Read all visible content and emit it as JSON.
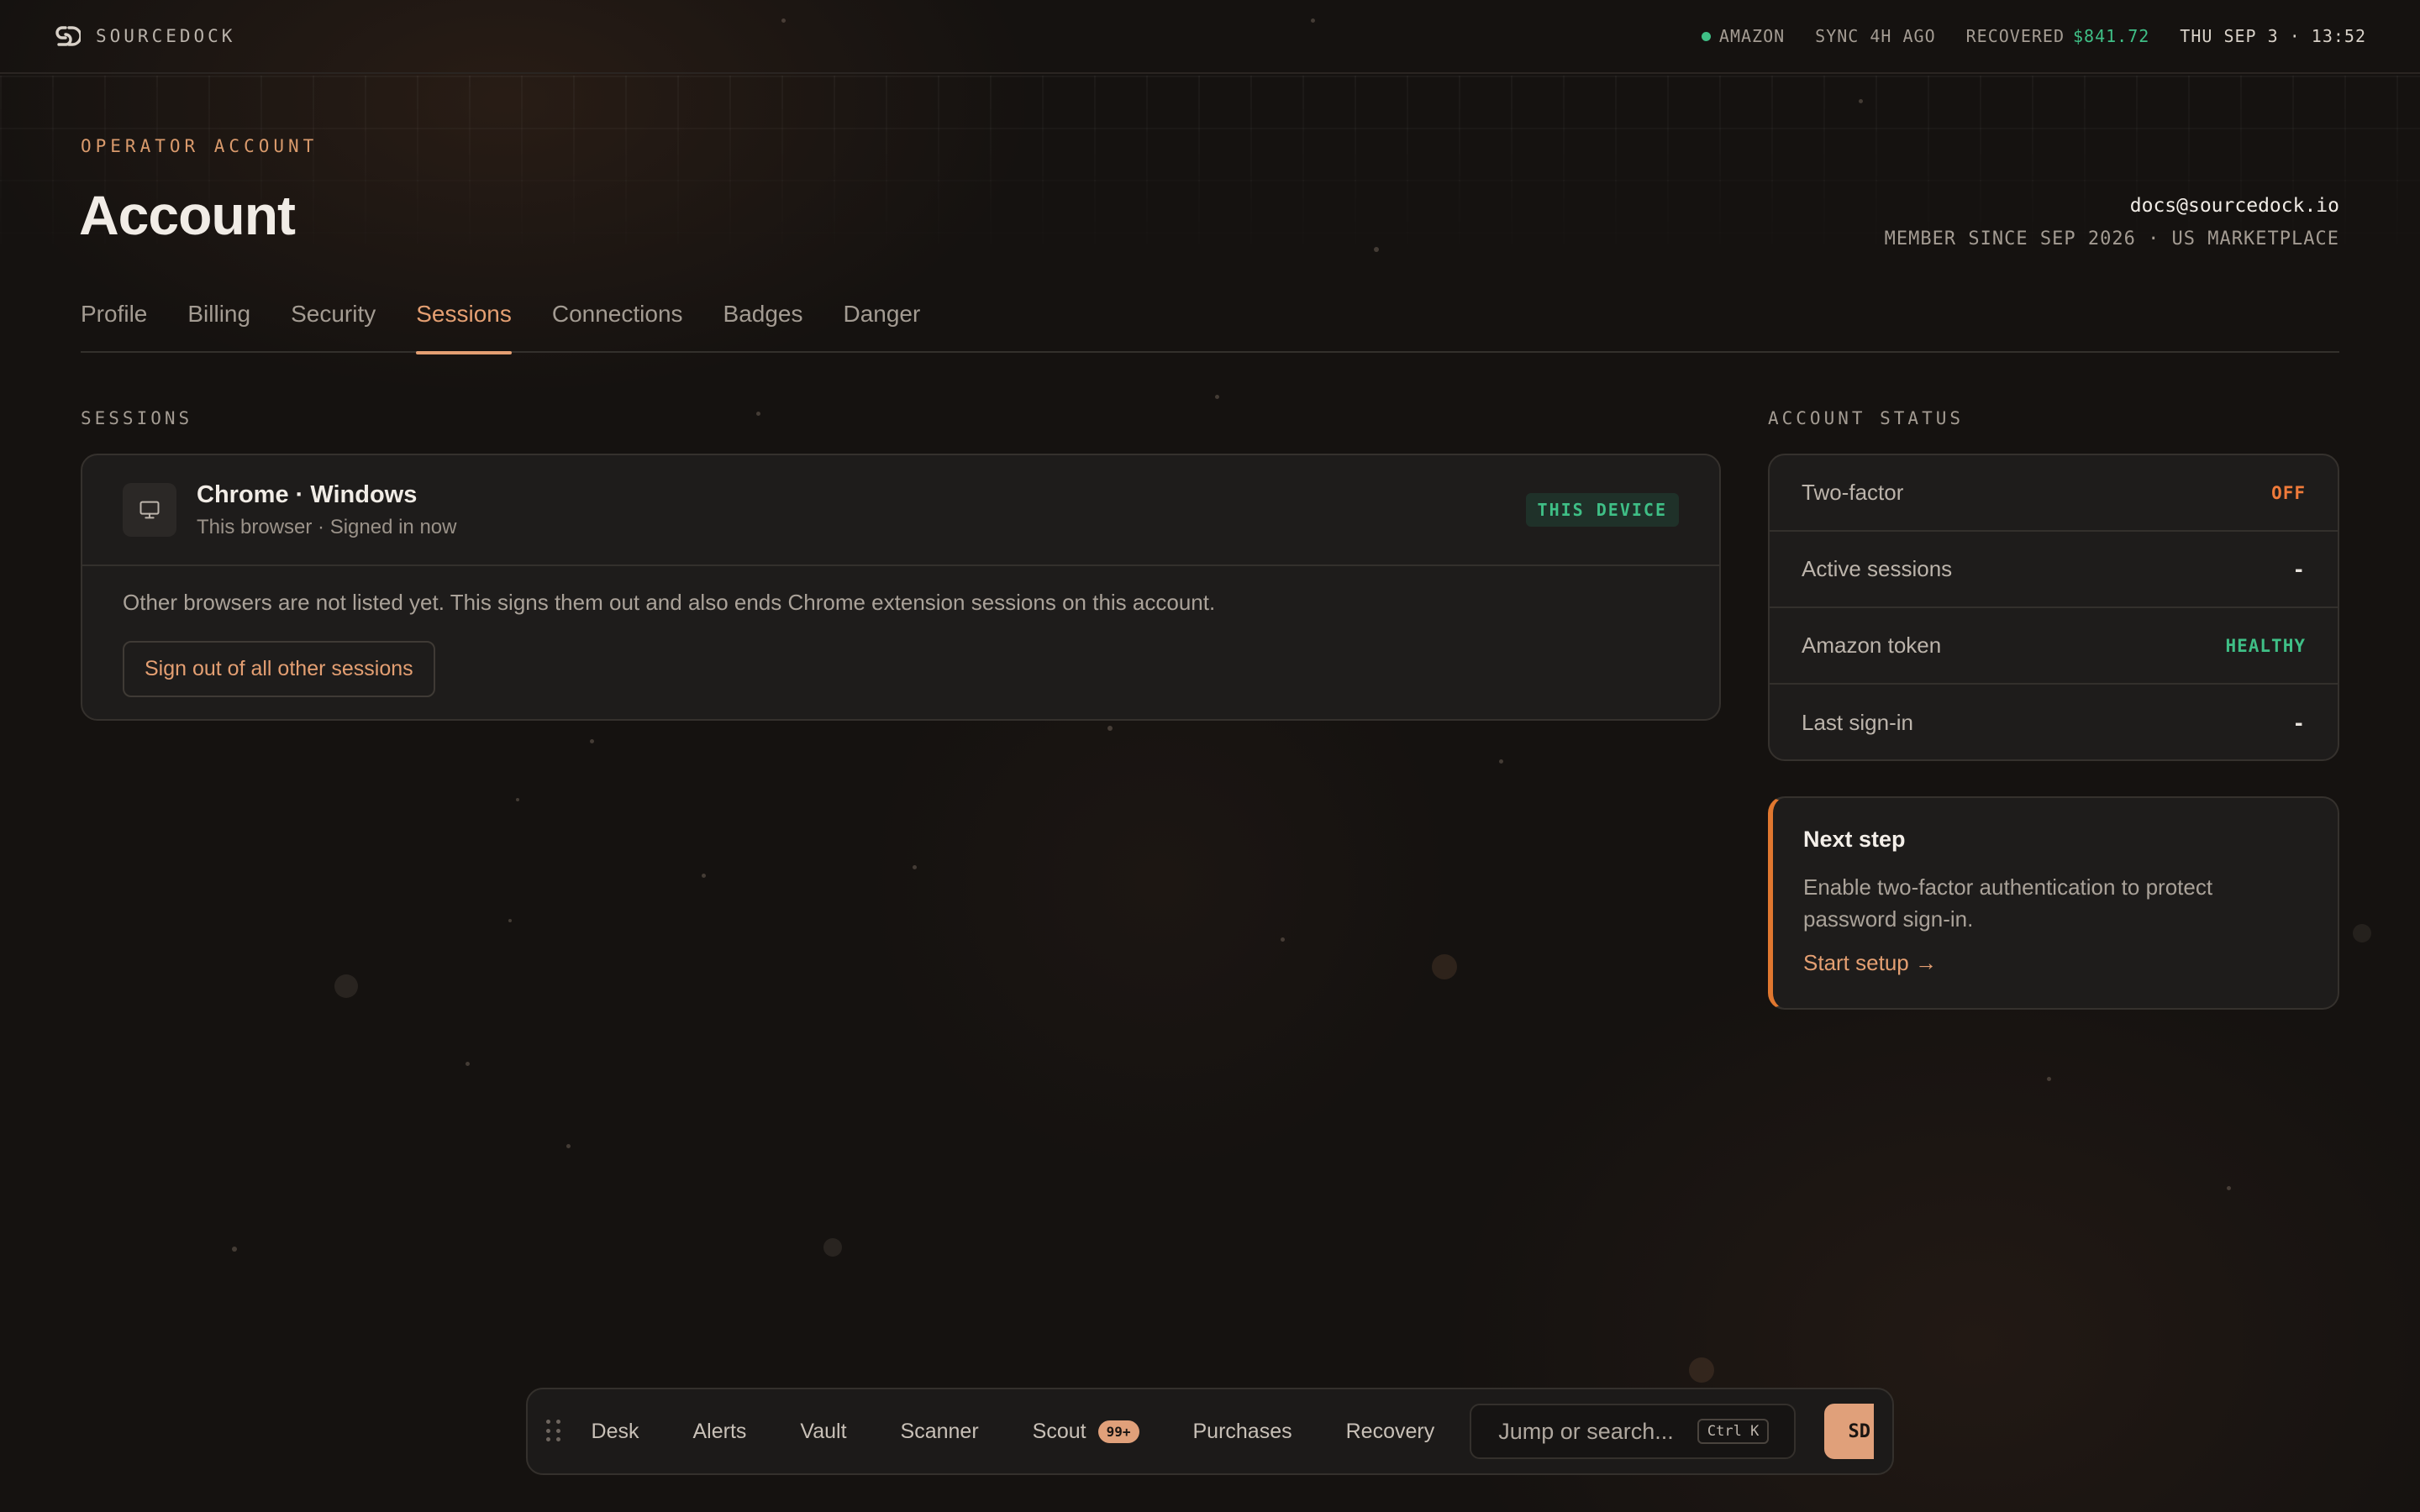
{
  "brand": {
    "name": "SOURCEDOCK"
  },
  "topbar": {
    "marketplace": "AMAZON",
    "sync": "SYNC 4H AGO",
    "recovered_label": "RECOVERED",
    "recovered_value": "$841.72",
    "datetime": "THU SEP 3 · 13:52"
  },
  "header": {
    "eyebrow": "OPERATOR ACCOUNT",
    "title": "Account",
    "email": "docs@sourcedock.io",
    "member_since": "MEMBER SINCE SEP 2026 · US MARKETPLACE"
  },
  "tabs": [
    {
      "label": "Profile",
      "active": false
    },
    {
      "label": "Billing",
      "active": false
    },
    {
      "label": "Security",
      "active": false
    },
    {
      "label": "Sessions",
      "active": true
    },
    {
      "label": "Connections",
      "active": false
    },
    {
      "label": "Badges",
      "active": false
    },
    {
      "label": "Danger",
      "active": false
    }
  ],
  "sessions": {
    "section_label": "SESSIONS",
    "current": {
      "title": "Chrome · Windows",
      "subtitle": "This browser · Signed in now",
      "badge": "THIS DEVICE",
      "icon": "monitor-icon"
    },
    "note": "Other browsers are not listed yet. This signs them out and also ends Chrome extension sessions on this account.",
    "action_label": "Sign out of all other sessions"
  },
  "account_status": {
    "section_label": "ACCOUNT STATUS",
    "rows": [
      {
        "label": "Two-factor",
        "value": "OFF",
        "tone": "off"
      },
      {
        "label": "Active sessions",
        "value": "-",
        "tone": "plain"
      },
      {
        "label": "Amazon token",
        "value": "HEALTHY",
        "tone": "ok"
      },
      {
        "label": "Last sign-in",
        "value": "-",
        "tone": "plain"
      }
    ]
  },
  "next_step": {
    "title": "Next step",
    "description": "Enable two-factor authentication to protect password sign-in.",
    "link_label": "Start setup →"
  },
  "dock": {
    "items": [
      {
        "label": "Desk"
      },
      {
        "label": "Alerts"
      },
      {
        "label": "Vault"
      },
      {
        "label": "Scanner"
      },
      {
        "label": "Scout",
        "badge": "99+"
      },
      {
        "label": "Purchases"
      },
      {
        "label": "Recovery"
      }
    ],
    "search_placeholder": "Jump or search...",
    "search_shortcut": "Ctrl K",
    "avatar_initials": "SD"
  },
  "colors": {
    "accent": "#e49f72",
    "success": "#3fbf86",
    "warning": "#ef7a3a",
    "background": "#151210"
  }
}
